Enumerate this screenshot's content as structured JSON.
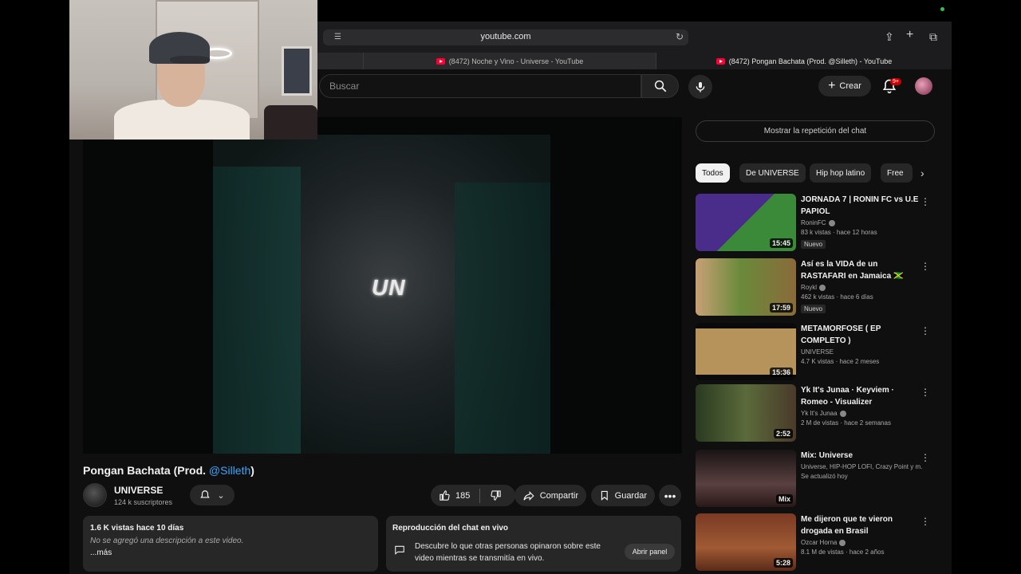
{
  "browser": {
    "url": "youtube.com",
    "tabs": [
      {
        "label": ""
      },
      {
        "label": "(8472) Noche y Vino - Universe - YouTube"
      },
      {
        "label": "(8472) Pongan Bachata (Prod. @Silleth) - YouTube"
      }
    ]
  },
  "header": {
    "search_placeholder": "Buscar",
    "create_label": "Crear",
    "notif_count": "9+"
  },
  "video": {
    "logo_text": "UN",
    "title": "Pongan Bachata (Prod. ",
    "title_mention": "@Silleth",
    "title_end": ")",
    "channel": "UNIVERSE",
    "subscribers": "124 k suscriptores",
    "likes": "185",
    "share_label": "Compartir",
    "save_label": "Guardar"
  },
  "description": {
    "stats": "1.6 K vistas  hace 10 días",
    "empty": "No se agregó una descripción a este video.",
    "more": "...más"
  },
  "live_chat": {
    "heading": "Reproducción del chat en vivo",
    "text": "Descubre lo que otras personas opinaron sobre este video mientras se transmitía en vivo.",
    "open_label": "Abrir panel",
    "replay_label": "Mostrar la repetición del chat"
  },
  "chips": [
    "Todos",
    "De UNIVERSE",
    "Hip hop latino",
    "Free"
  ],
  "recommendations": [
    {
      "title": "JORNADA 7 | RONIN FC vs U.E PAPIOL",
      "channel": "RoninFC",
      "meta": "83 k vistas · hace 12 horas",
      "badge": "Nuevo",
      "duration": "15:45"
    },
    {
      "title": "Así es la VIDA de un RASTAFARI en Jamaica 🇯🇲",
      "channel": "Roykl",
      "meta": "462 k vistas · hace 6 días",
      "badge": "Nuevo",
      "duration": "17:59"
    },
    {
      "title": "METAMORFOSE ( EP COMPLETO )",
      "channel": "UNIVERSE",
      "meta": "4.7 K vistas · hace 2 meses",
      "badge": "",
      "duration": "15:36"
    },
    {
      "title": "Yk It's Junaa · Keyviem · Romeo - Visualizer",
      "channel": "Yk It's Junaa",
      "meta": "2 M de vistas · hace 2 semanas",
      "badge": "",
      "duration": "2:52"
    },
    {
      "title": "Mix: Universe",
      "channel": "Universe, HIP-HOP LOFI, Crazy Point y m...",
      "meta": "Se actualizó hoy",
      "badge": "",
      "duration": "Mix"
    },
    {
      "title": "Me dijeron que te vieron drogada en Brasil",
      "channel": "Ozcar Horna",
      "meta": "8.1 M de vistas · hace 2 años",
      "badge": "",
      "duration": "5:28"
    }
  ]
}
